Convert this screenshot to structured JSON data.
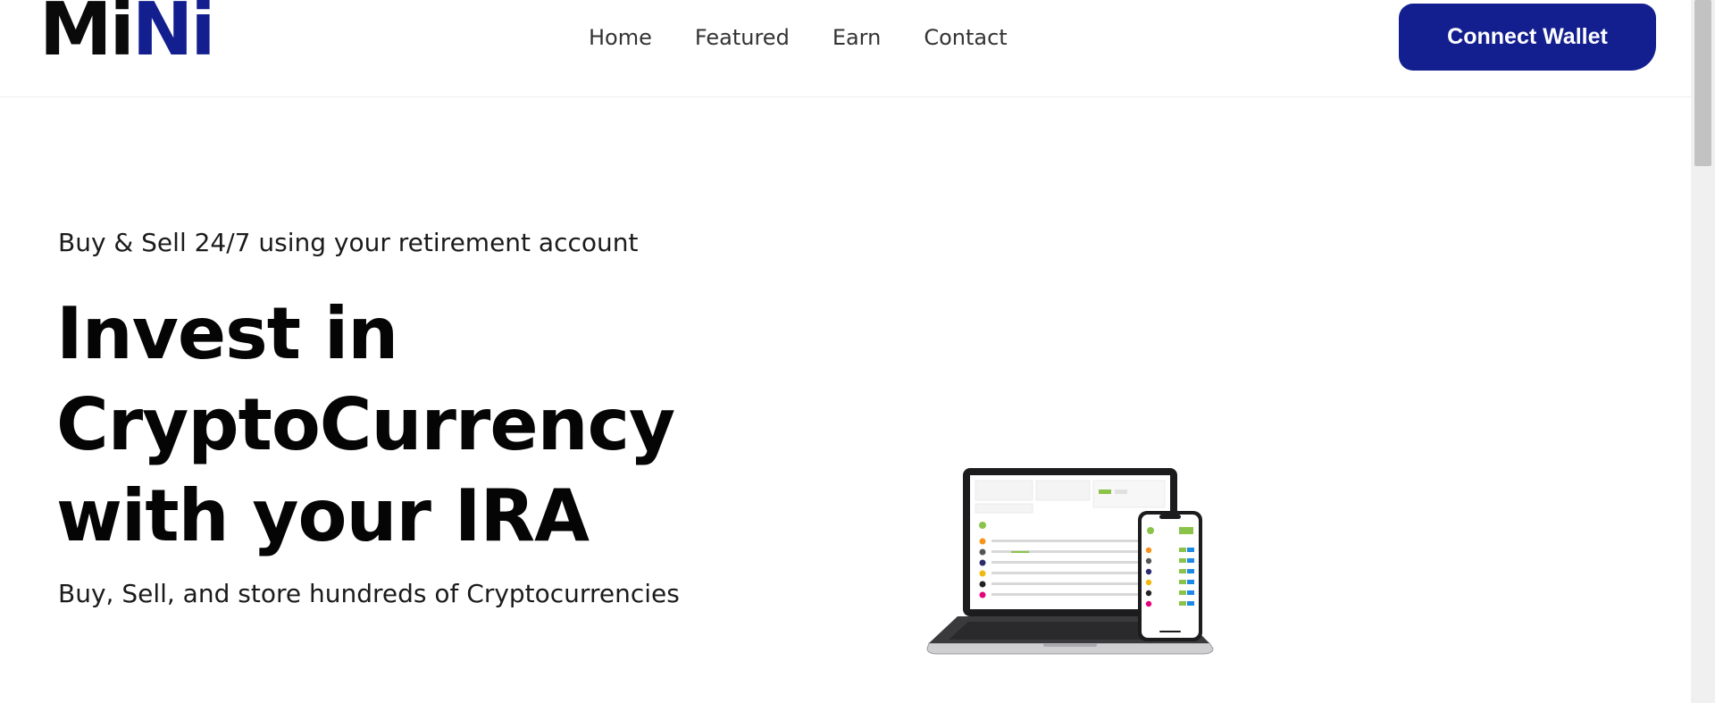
{
  "header": {
    "logo": {
      "part1": "Mi",
      "part2": "Ni"
    },
    "nav": [
      {
        "label": "Home"
      },
      {
        "label": "Featured"
      },
      {
        "label": "Earn"
      },
      {
        "label": "Contact"
      }
    ],
    "connect_label": "Connect Wallet"
  },
  "hero": {
    "subtitle": "Buy & Sell 24/7 using your retirement account",
    "headline_lines": [
      "Invest in",
      "CryptoCurrency",
      "with your IRA"
    ],
    "tagline": "Buy, Sell, and store hundreds of Cryptocurrencies"
  },
  "colors": {
    "brand": "#141f8f",
    "text": "#050505"
  },
  "illustration": "laptop-and-phone-trading-dashboard"
}
